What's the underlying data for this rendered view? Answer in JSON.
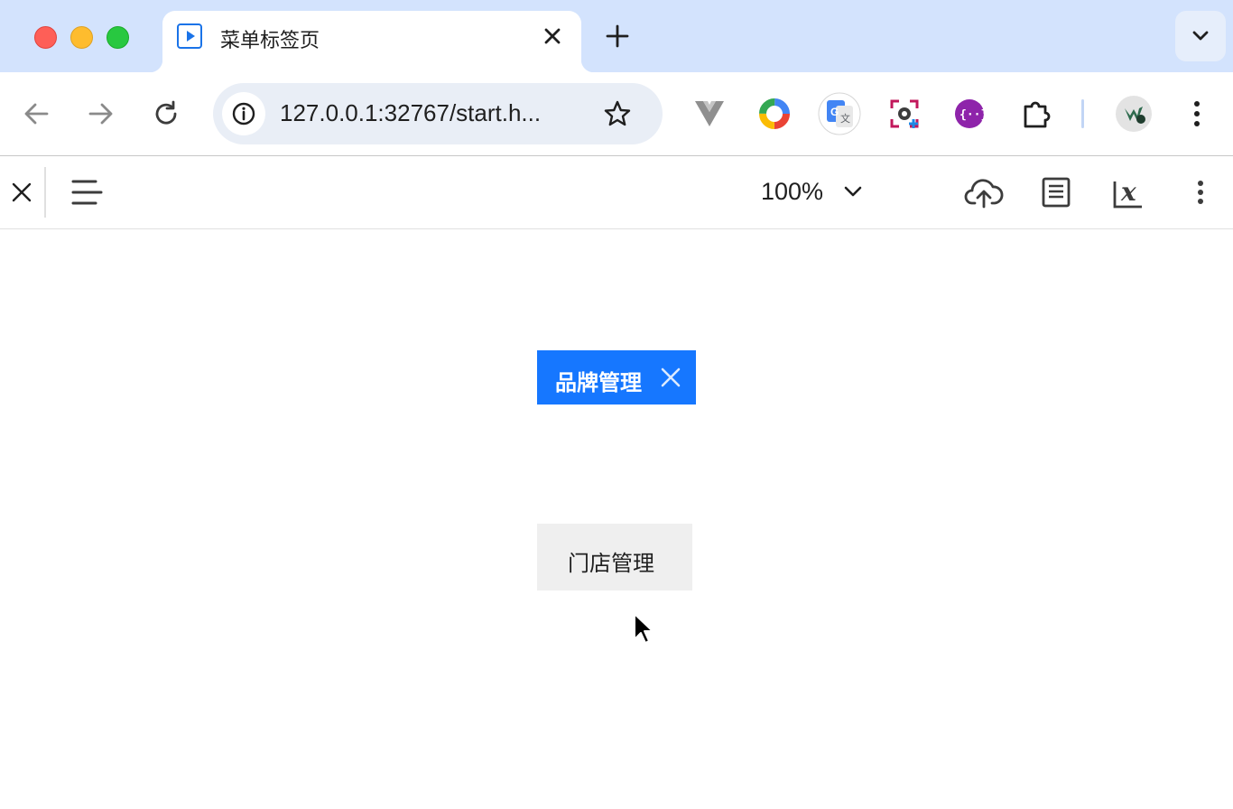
{
  "browser": {
    "tab": {
      "title": "菜单标签页"
    },
    "omnibox": {
      "url": "127.0.0.1:32767/start.h..."
    },
    "viewer": {
      "zoom": "100%"
    }
  },
  "page": {
    "tags": [
      {
        "label": "品牌管理",
        "active": true
      },
      {
        "label": "门店管理",
        "active": false
      }
    ]
  },
  "colors": {
    "tabstrip": "#d3e3fd",
    "active_tag": "#1677ff",
    "inactive_tag": "#efefef"
  }
}
